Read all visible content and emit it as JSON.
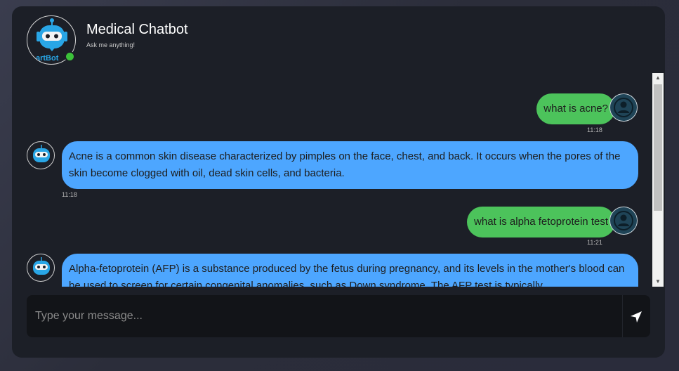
{
  "header": {
    "title": "Medical Chatbot",
    "subtitle": "Ask me anything!",
    "logo_icon": "robot-logo-icon",
    "logo_text": "artBot",
    "status": "online",
    "status_color": "#3cc23a"
  },
  "messages": [
    {
      "role": "user",
      "text": "what is acne?",
      "time": "11:18"
    },
    {
      "role": "bot",
      "text": "Acne is a common skin disease characterized by pimples on the face, chest, and back. It occurs when the pores of the skin become clogged with oil, dead skin cells, and bacteria.",
      "time": "11:18"
    },
    {
      "role": "user",
      "text": "what is alpha fetoprotein test",
      "time": "11:21"
    },
    {
      "role": "bot",
      "text": "Alpha-fetoprotein (AFP) is a substance produced by the fetus during pregnancy, and its levels in the mother's blood can be used to screen for certain congenital anomalies, such as Down syndrome. The AFP test is typically",
      "time": ""
    }
  ],
  "composer": {
    "placeholder": "Type your message...",
    "value": "",
    "send_icon": "send-icon"
  },
  "colors": {
    "user_bubble": "#4cc35b",
    "bot_bubble": "#4da6ff",
    "card_background": "#1c1f27"
  }
}
